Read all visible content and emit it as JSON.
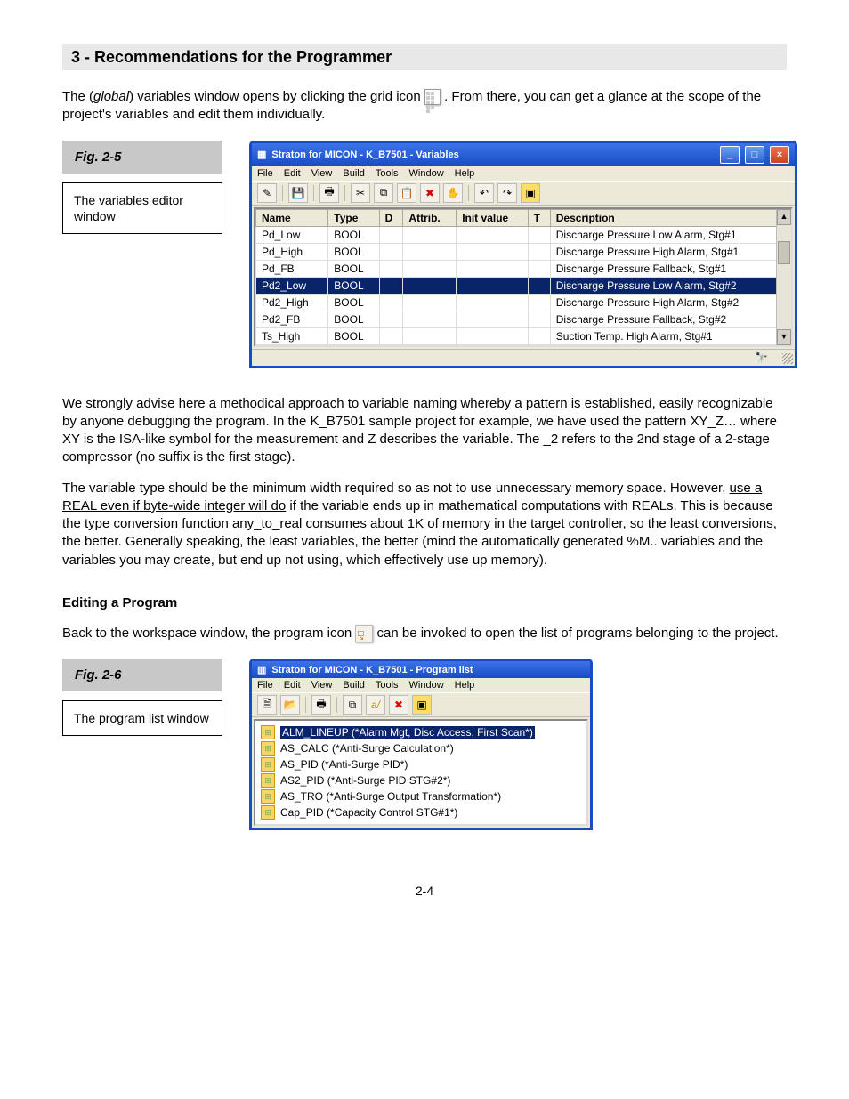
{
  "section_heading": "3 - Recommendations for the Programmer",
  "vars_intro": [
    "The (",
    "global",
    ") variables window opens by clicking the grid icon ",
    " .  From there, you can get a glance at the scope of the project's variables and edit them individually."
  ],
  "fig2_5": {
    "label": "Fig. 2-5",
    "caption": "The variables editor window"
  },
  "vars_win": {
    "title": "Straton for MICON - K_B7501 - Variables",
    "menus": [
      "File",
      "Edit",
      "View",
      "Build",
      "Tools",
      "Window",
      "Help"
    ],
    "cols": [
      "Name",
      "Type",
      "D",
      "Attrib.",
      "Init value",
      "T",
      "Description"
    ],
    "rows": [
      {
        "name": "Pd_Low",
        "type": "BOOL",
        "desc": "Discharge Pressure Low Alarm, Stg#1"
      },
      {
        "name": "Pd_High",
        "type": "BOOL",
        "desc": "Discharge Pressure High Alarm, Stg#1"
      },
      {
        "name": "Pd_FB",
        "type": "BOOL",
        "desc": "Discharge Pressure Fallback, Stg#1"
      },
      {
        "name": "Pd2_Low",
        "type": "BOOL",
        "desc": "Discharge Pressure Low Alarm, Stg#2",
        "sel": true
      },
      {
        "name": "Pd2_High",
        "type": "BOOL",
        "desc": "Discharge Pressure High Alarm, Stg#2"
      },
      {
        "name": "Pd2_FB",
        "type": "BOOL",
        "desc": "Discharge Pressure Fallback, Stg#2"
      },
      {
        "name": "Ts_High",
        "type": "BOOL",
        "desc": "Suction Temp. High Alarm, Stg#1"
      }
    ]
  },
  "vars_para1": "We strongly advise here a methodical approach to variable naming whereby a pattern is established, easily recognizable by anyone debugging the program.  In the K_B7501 sample project for example, we have used the pattern XY_Z… where XY is the ISA-like symbol for the measurement and Z describes the variable.  The _2 refers to the 2nd stage of a 2-stage compressor (no suffix is the first stage).",
  "vars_para2_parts": [
    "The variable type should be the minimum width required so as not to use unnecessary memory space.  However, ",
    " use a REAL even if byte-wide integer will do",
    " if the variable ends up in mathematical computations with REALs.  This is because the type conversion function any_to_real consumes about 1K of memory in the target controller, so the least conversions, the better.  Generally speaking, the least variables, the better (mind the automatically generated %M.. variables and the variables you may create, but end up not using, which effectively use up memory)."
  ],
  "h_edit": "Editing a Program",
  "prog_intro_parts": [
    "Back to the workspace window, the program icon  ",
    "  can be invoked to open the list of programs belonging to the project."
  ],
  "fig2_6": {
    "label": "Fig. 2-6",
    "caption": "The program list window"
  },
  "prog_win": {
    "title": "Straton for MICON - K_B7501 - Program list",
    "menus": [
      "File",
      "Edit",
      "View",
      "Build",
      "Tools",
      "Window",
      "Help"
    ],
    "items": [
      {
        "name": "ALM_LINEUP",
        "desc": "(*Alarm Mgt, Disc Access, First Scan*)",
        "sel": true
      },
      {
        "name": "AS_CALC",
        "desc": "(*Anti-Surge Calculation*)"
      },
      {
        "name": "AS_PID",
        "desc": "(*Anti-Surge PID*)"
      },
      {
        "name": "AS2_PID",
        "desc": "(*Anti-Surge PID STG#2*)"
      },
      {
        "name": "AS_TRO",
        "desc": "(*Anti-Surge Output Transformation*)"
      },
      {
        "name": "Cap_PID",
        "desc": "(*Capacity Control STG#1*)"
      }
    ]
  },
  "footer_page": "2-4"
}
